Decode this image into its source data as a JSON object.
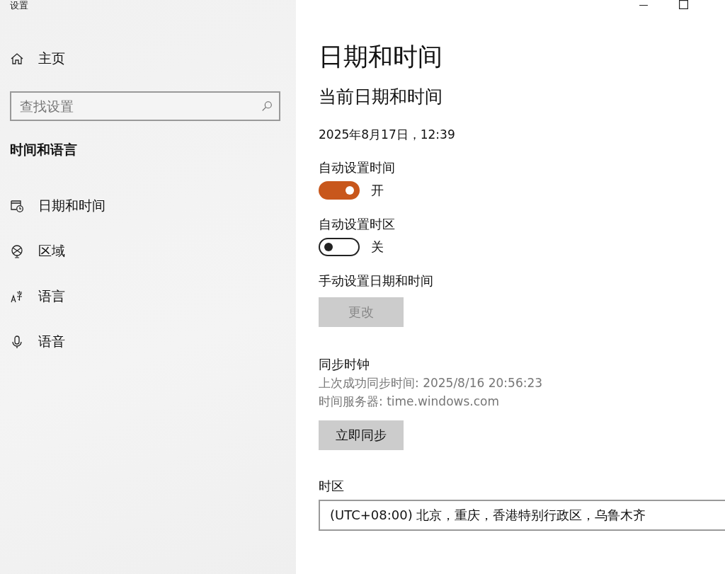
{
  "window": {
    "title": "设置"
  },
  "sidebar": {
    "home": "主页",
    "search": {
      "placeholder": "查找设置"
    },
    "section": "时间和语言",
    "items": [
      {
        "label": "日期和时间",
        "kind": "calendar"
      },
      {
        "label": "区域",
        "kind": "globe"
      },
      {
        "label": "语言",
        "kind": "language"
      },
      {
        "label": "语音",
        "kind": "microphone"
      }
    ]
  },
  "content": {
    "title": "日期和时间",
    "subtitle": "当前日期和时间",
    "current": "2025年8月17日，12:39",
    "settings": [
      {
        "kind": "toggle",
        "label": "自动设置时间",
        "on": true,
        "state_text": "开"
      },
      {
        "kind": "toggle",
        "label": "自动设置时区",
        "on": false,
        "state_text": "关"
      },
      {
        "kind": "button",
        "label": "手动设置日期和时间",
        "button": "更改",
        "disabled": true
      }
    ],
    "sync": {
      "heading": "同步时钟",
      "lines": [
        "上次成功同步时间: 2025/8/16 20:56:23",
        "时间服务器: time.windows.com"
      ],
      "button": "立即同步"
    },
    "timezone": {
      "label": "时区",
      "value": "(UTC+08:00) 北京，重庆，香港特别行政区，乌鲁木齐"
    }
  }
}
